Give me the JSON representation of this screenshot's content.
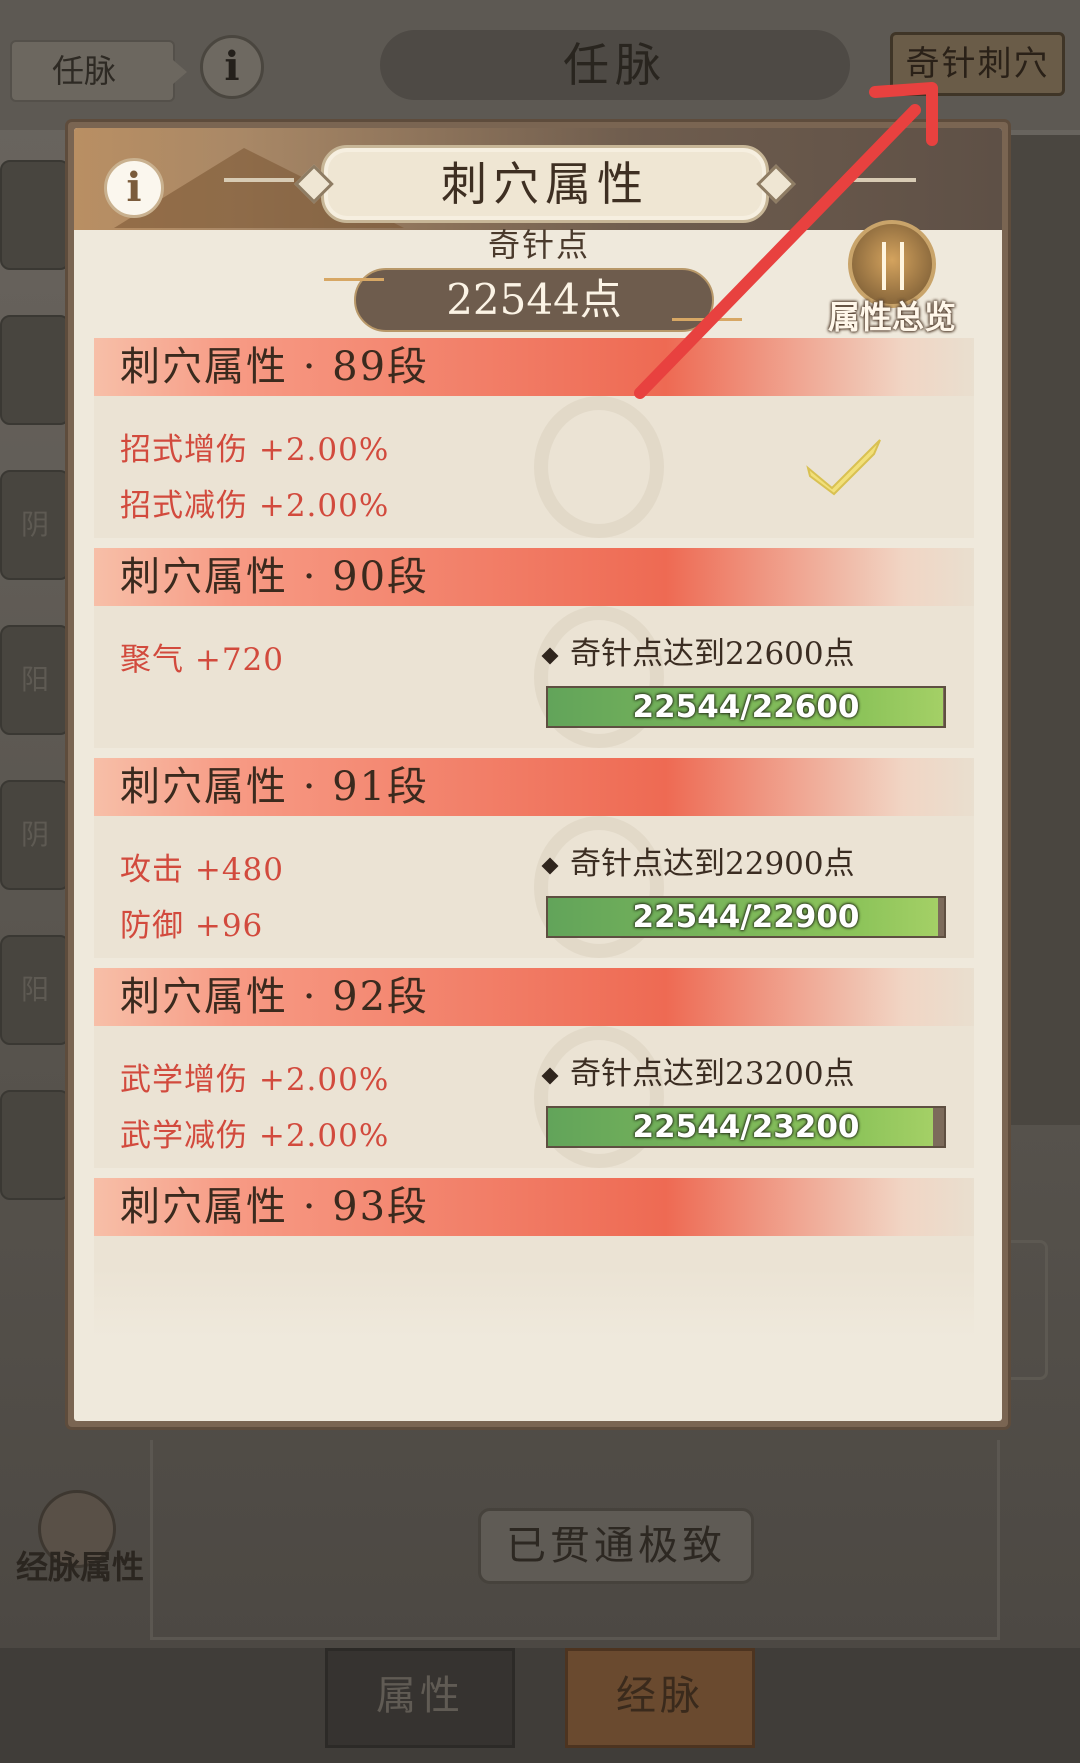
{
  "background": {
    "breadcrumb": "任脉",
    "info_glyph": "i",
    "title": "任脉",
    "qizhen_button": "奇针刺穴",
    "side_tabs": [
      "",
      "",
      "阴",
      "阳",
      "阴",
      "阳",
      ""
    ],
    "jingmai_attr_label": "经脉属性",
    "status_button": "已贯通极致",
    "bottom_tabs": [
      "属性",
      "经脉"
    ]
  },
  "modal": {
    "info_glyph": "i",
    "title": "刺穴属性",
    "points_label": "奇针点",
    "points_value": "22544点",
    "overview_label": "属性总览"
  },
  "tiers": [
    {
      "header": "刺穴属性 · 89段",
      "stats": [
        "招式增伤 +2.00%",
        "招式减伤 +2.00%"
      ],
      "completed": true
    },
    {
      "header": "刺穴属性 · 90段",
      "stats": [
        "聚气 +720"
      ],
      "requirement": "奇针点达到22600点",
      "progress_text": "22544/22600",
      "progress_fraction": 0.9975
    },
    {
      "header": "刺穴属性 · 91段",
      "stats": [
        "攻击 +480",
        "防御 +96"
      ],
      "requirement": "奇针点达到22900点",
      "progress_text": "22544/22900",
      "progress_fraction": 0.9845
    },
    {
      "header": "刺穴属性 · 92段",
      "stats": [
        "武学增伤 +2.00%",
        "武学减伤 +2.00%"
      ],
      "requirement": "奇针点达到23200点",
      "progress_text": "22544/23200",
      "progress_fraction": 0.9717
    },
    {
      "header": "刺穴属性 · 93段"
    }
  ],
  "colors": {
    "stat_text": "#d24a3d",
    "progress_fill": "#8dc45a",
    "header_gradient_mid": "#ee6a53",
    "annotation_arrow": "#e8413f"
  }
}
